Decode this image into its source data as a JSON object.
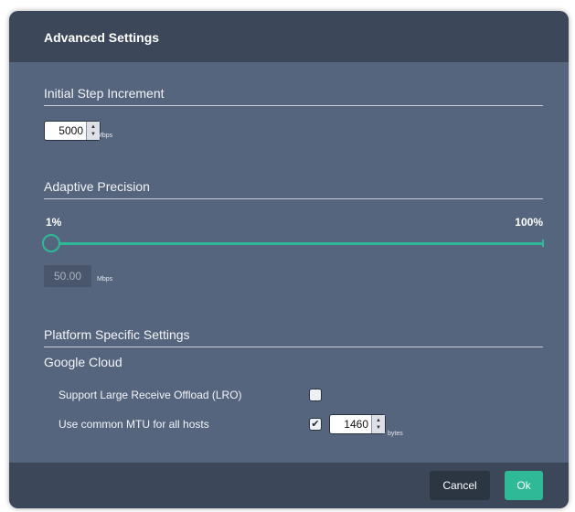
{
  "dialog": {
    "title": "Advanced Settings"
  },
  "step_increment": {
    "title": "Initial Step Increment",
    "value": "5000",
    "unit": "Mbps"
  },
  "adaptive_precision": {
    "title": "Adaptive Precision",
    "min_label": "1%",
    "max_label": "100%",
    "slider_value_percent": 1,
    "value": "50.00",
    "unit": "Mbps"
  },
  "platform": {
    "title": "Platform Specific Settings",
    "provider": "Google Cloud",
    "lro_label": "Support Large Receive Offload (LRO)",
    "lro_checked": false,
    "mtu_label": "Use common MTU for all hosts",
    "mtu_checked": true,
    "mtu_value": "1460",
    "mtu_unit": "bytes"
  },
  "footer": {
    "cancel_label": "Cancel",
    "ok_label": "Ok"
  },
  "colors": {
    "accent": "#2fb996",
    "panel": "#56657e",
    "header": "#3c4859"
  }
}
